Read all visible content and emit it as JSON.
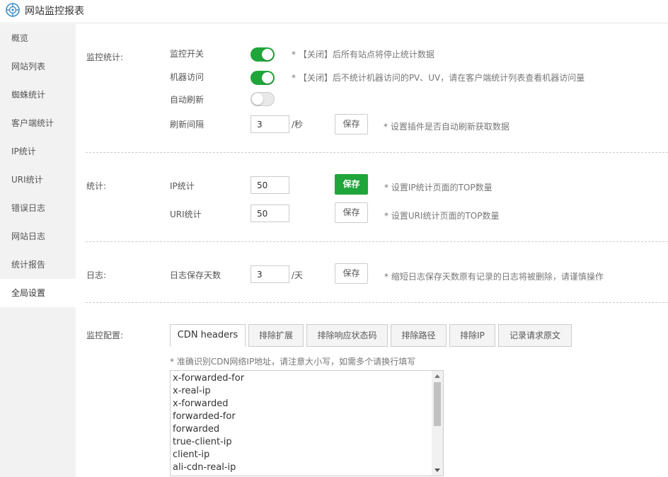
{
  "app": {
    "title": "网站监控报表",
    "logo_icon": "monitor-globe-icon",
    "accent": "#20a53a"
  },
  "sidebar": {
    "items": [
      {
        "label": "概览"
      },
      {
        "label": "网站列表"
      },
      {
        "label": "蜘蛛统计"
      },
      {
        "label": "客户端统计"
      },
      {
        "label": "IP统计"
      },
      {
        "label": "URI统计"
      },
      {
        "label": "错误日志"
      },
      {
        "label": "网站日志"
      },
      {
        "label": "统计报告"
      },
      {
        "label": "全局设置",
        "active": true
      }
    ]
  },
  "monitor": {
    "section_label": "监控统计:",
    "switch_label": "监控开关",
    "switch_on": true,
    "switch_hint": "* 【关闭】后所有站点将停止统计数据",
    "robot_label": "机器访问",
    "robot_on": true,
    "robot_hint": "* 【关闭】后不统计机器访问的PV、UV，请在客户端统计列表查看机器访问量",
    "autorefresh_label": "自动刷新",
    "autorefresh_on": false,
    "interval_label": "刷新间隔",
    "interval_value": "3",
    "interval_unit": "/秒",
    "interval_save": "保存",
    "interval_hint": "* 设置插件是否自动刷新获取数据"
  },
  "stats": {
    "section_label": "统计:",
    "ip_label": "IP统计",
    "ip_value": "50",
    "ip_save": "保存",
    "ip_hint": "* 设置IP统计页面的TOP数量",
    "uri_label": "URI统计",
    "uri_value": "50",
    "uri_save": "保存",
    "uri_hint": "* 设置URI统计页面的TOP数量"
  },
  "log": {
    "section_label": "日志:",
    "days_label": "日志保存天数",
    "days_value": "3",
    "days_unit": "/天",
    "days_save": "保存",
    "days_hint": "* 缩短日志保存天数原有记录的日志将被删除，请谨慎操作"
  },
  "config": {
    "section_label": "监控配置:",
    "tabs": [
      {
        "label": "CDN headers",
        "active": true
      },
      {
        "label": "排除扩展"
      },
      {
        "label": "排除响应状态码"
      },
      {
        "label": "排除路径"
      },
      {
        "label": "排除IP"
      },
      {
        "label": "记录请求原文"
      }
    ],
    "cdn_hint": "* 准确识别CDN网络IP地址，请注意大小写，如需多个请换行填写",
    "cdn_headers": [
      "x-forwarded-for",
      "x-real-ip",
      "x-forwarded",
      "forwarded-for",
      "forwarded",
      "true-client-ip",
      "client-ip",
      "ali-cdn-real-ip"
    ]
  }
}
